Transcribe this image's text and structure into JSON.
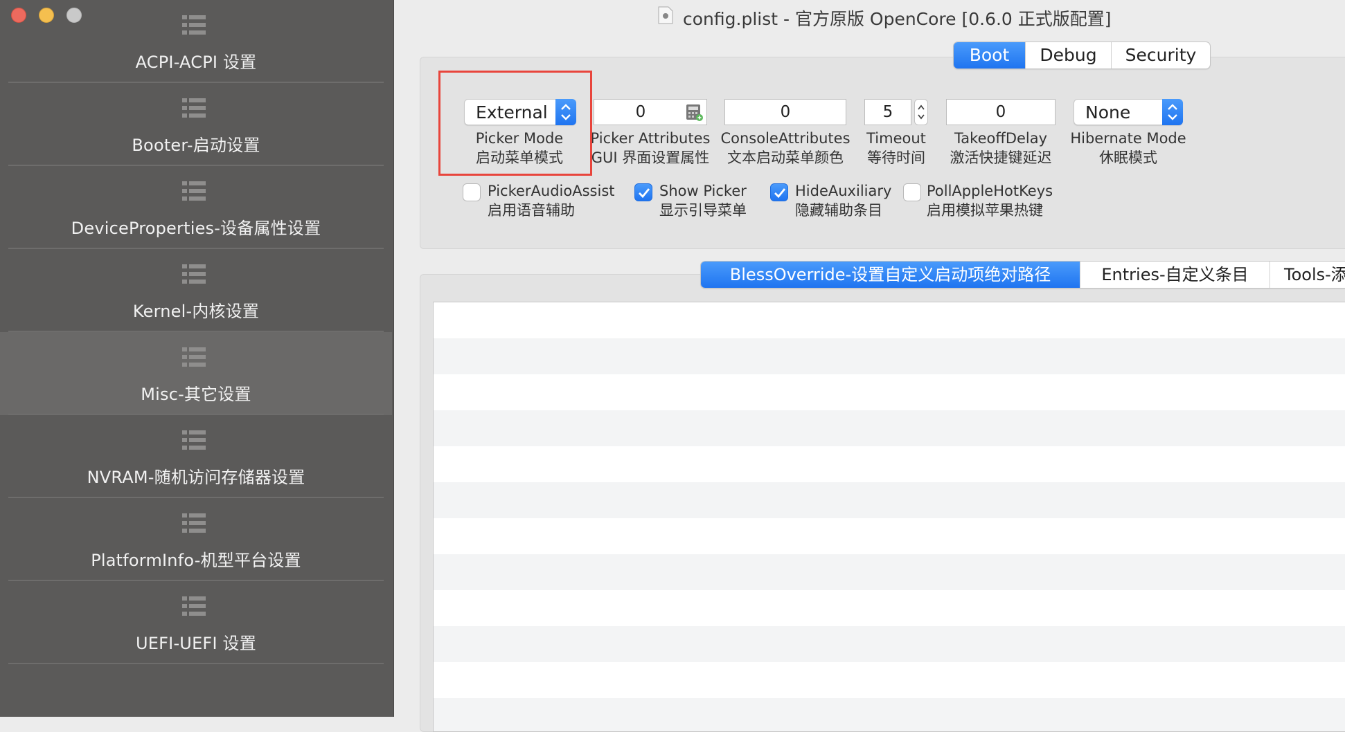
{
  "window": {
    "title": "config.plist - 官方原版 OpenCore [0.6.0 正式版配置]",
    "traffic_lights": [
      "close",
      "minimize",
      "zoom"
    ]
  },
  "sidebar": {
    "items": [
      {
        "label": "ACPI-ACPI 设置",
        "icon": "list-icon"
      },
      {
        "label": "Booter-启动设置",
        "icon": "list-icon"
      },
      {
        "label": "DeviceProperties-设备属性设置",
        "icon": "list-icon"
      },
      {
        "label": "Kernel-内核设置",
        "icon": "list-icon"
      },
      {
        "label": "Misc-其它设置",
        "icon": "list-icon",
        "selected": true
      },
      {
        "label": "NVRAM-随机访问存储器设置",
        "icon": "list-icon"
      },
      {
        "label": "PlatformInfo-机型平台设置",
        "icon": "list-icon"
      },
      {
        "label": "UEFI-UEFI 设置",
        "icon": "list-icon"
      }
    ]
  },
  "top_tabs": [
    {
      "label": "Boot",
      "active": true
    },
    {
      "label": "Debug",
      "active": false
    },
    {
      "label": "Security",
      "active": false
    }
  ],
  "boot": {
    "picker_mode": {
      "value": "External",
      "label_en": "Picker Mode",
      "label_cn": "启动菜单模式"
    },
    "picker_attributes": {
      "value": "0",
      "label_en": "Picker Attributes",
      "label_cn": "GUI 界面设置属性"
    },
    "console_attributes": {
      "value": "0",
      "label_en": "ConsoleAttributes",
      "label_cn": "文本启动菜单颜色"
    },
    "timeout": {
      "value": "5",
      "label_en": "Timeout",
      "label_cn": "等待时间"
    },
    "takeoff_delay": {
      "value": "0",
      "label_en": "TakeoffDelay",
      "label_cn": "激活快捷键延迟"
    },
    "hibernate_mode": {
      "value": "None",
      "label_en": "Hibernate Mode",
      "label_cn": "休眠模式"
    },
    "checkboxes": [
      {
        "label_en": "PickerAudioAssist",
        "label_cn": "启用语音辅助",
        "checked": false
      },
      {
        "label_en": "Show Picker",
        "label_cn": "显示引导菜单",
        "checked": true
      },
      {
        "label_en": "HideAuxiliary",
        "label_cn": "隐藏辅助条目",
        "checked": true
      },
      {
        "label_en": "PollAppleHotKeys",
        "label_cn": "启用模拟苹果热键",
        "checked": false
      }
    ]
  },
  "bottom_tabs": [
    {
      "label": "BlessOverride-设置自定义启动项绝对路径",
      "active": true
    },
    {
      "label": "Entries-自定义条目",
      "active": false
    },
    {
      "label": "Tools-添",
      "active": false
    }
  ],
  "colors": {
    "accent": "#1f74f0",
    "sidebar_bg": "#5b5a59",
    "highlight": "#e8453c"
  }
}
